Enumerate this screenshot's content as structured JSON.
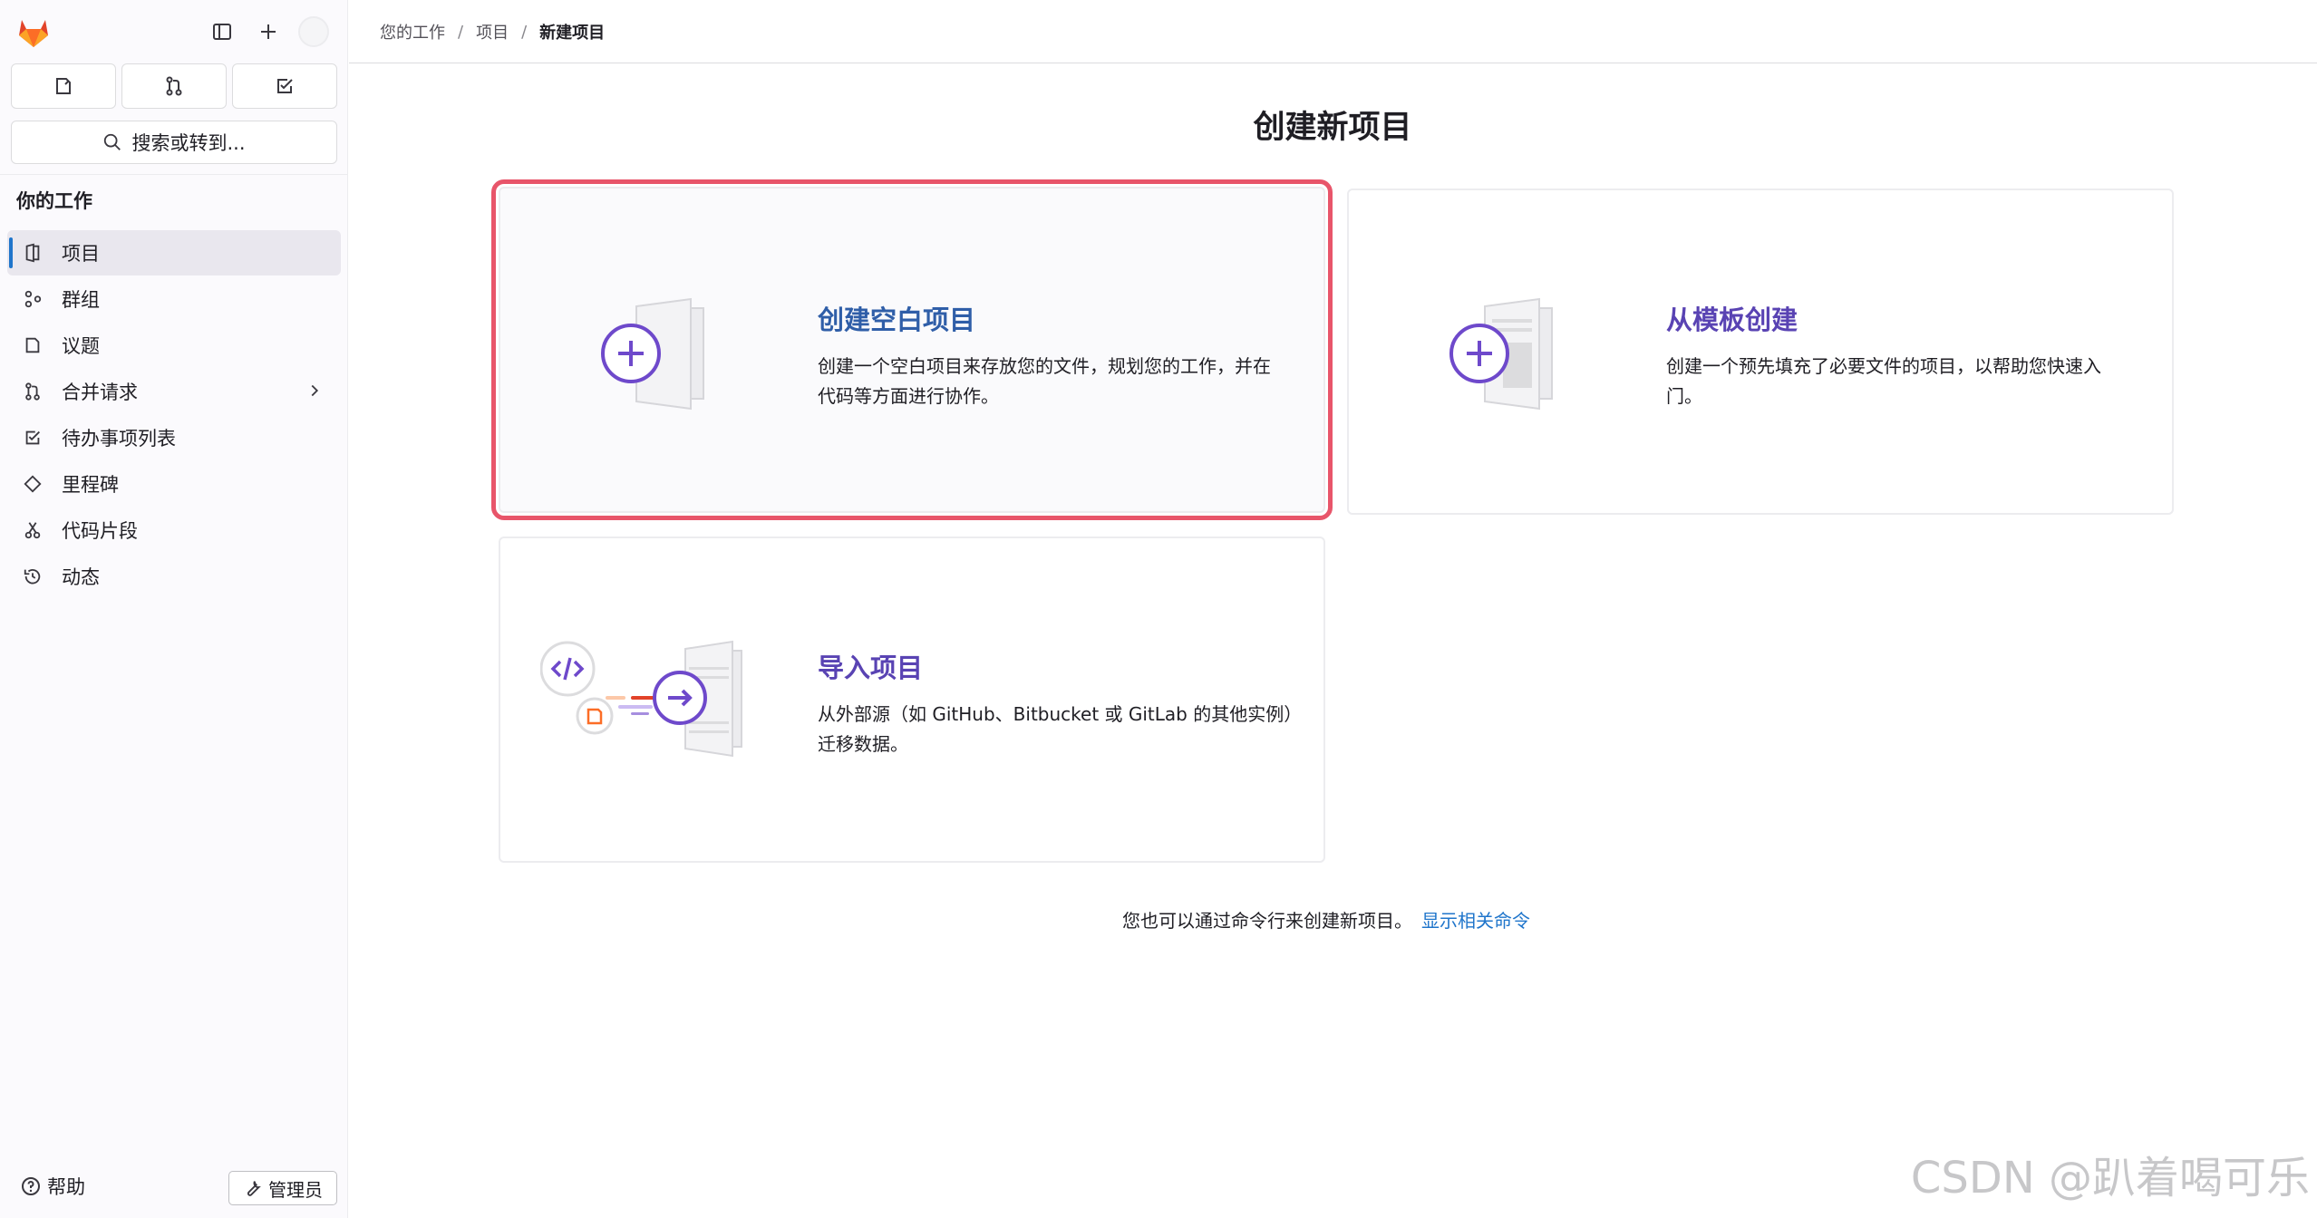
{
  "sidebar": {
    "search_label": "搜索或转到...",
    "section_title": "你的工作",
    "items": [
      {
        "label": "项目",
        "active": true
      },
      {
        "label": "群组"
      },
      {
        "label": "议题"
      },
      {
        "label": "合并请求",
        "has_submenu": true
      },
      {
        "label": "待办事项列表"
      },
      {
        "label": "里程碑"
      },
      {
        "label": "代码片段"
      },
      {
        "label": "动态"
      }
    ],
    "help_label": "帮助",
    "admin_label": "管理员"
  },
  "breadcrumb": {
    "items": [
      "您的工作",
      "项目"
    ],
    "current": "新建项目"
  },
  "main": {
    "title": "创建新项目",
    "cards": [
      {
        "title": "创建空白项目",
        "desc_line1": "创建一个空白项目来存放您的文件，规划您的工作，并在",
        "desc_line2": "代码等方面进行协作。",
        "highlighted": true
      },
      {
        "title": "从模板创建",
        "desc_line1": "创建一个预先填充了必要文件的项目，以帮助您快速入",
        "desc_line2": "门。"
      },
      {
        "title": "导入项目",
        "desc_line1": "从外部源（如 GitHub、Bitbucket 或 GitLab 的其他实例）",
        "desc_line2": "迁移数据。"
      }
    ],
    "footer_text": "您也可以通过命令行来创建新项目。",
    "footer_link": "显示相关命令"
  },
  "watermark": "CSDN @趴着喝可乐",
  "colors": {
    "accent_blue": "#1f75cb",
    "highlight_red": "#e8556a",
    "illustration_purple": "#6e49cb"
  }
}
